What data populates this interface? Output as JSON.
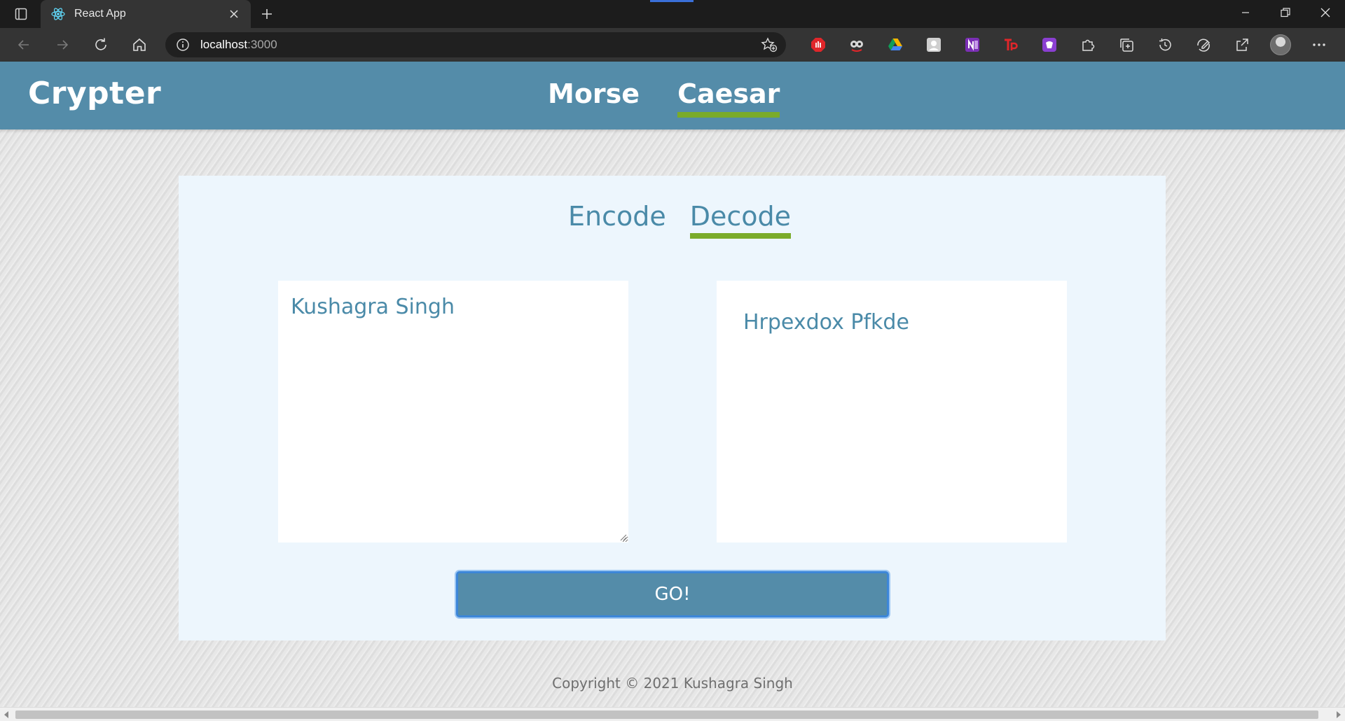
{
  "browser": {
    "tab_title": "React App",
    "url_host": "localhost",
    "url_port": ":3000",
    "extensions": [
      {
        "name": "adblock-icon",
        "color": "#e0262a"
      },
      {
        "name": "eyes-extension-icon",
        "color": "#d7d7d7"
      },
      {
        "name": "google-drive-icon",
        "color": "#f4b400"
      },
      {
        "name": "profile-extension-icon",
        "color": "#cfcfcf"
      },
      {
        "name": "onenote-icon",
        "color": "#7b2fb5"
      },
      {
        "name": "tp-extension-icon",
        "color": "#e0262a"
      },
      {
        "name": "purple-extension-icon",
        "color": "#8a3fd1"
      }
    ]
  },
  "header": {
    "brand": "Crypter",
    "nav": [
      "Morse",
      "Caesar"
    ],
    "active_nav": "Caesar"
  },
  "converter": {
    "modes": [
      "Encode",
      "Decode"
    ],
    "active_mode": "Decode",
    "input_value": "Kushagra Singh",
    "output_value": "Hrpexdox Pfkde",
    "go_label": "GO!"
  },
  "footer": {
    "text": "Copyright © 2021 Kushagra Singh"
  },
  "colors": {
    "header_bg": "#548ca9",
    "accent_underline": "#7aab2a",
    "card_bg": "#edf6fd",
    "text_blue": "#4a8aa8"
  }
}
